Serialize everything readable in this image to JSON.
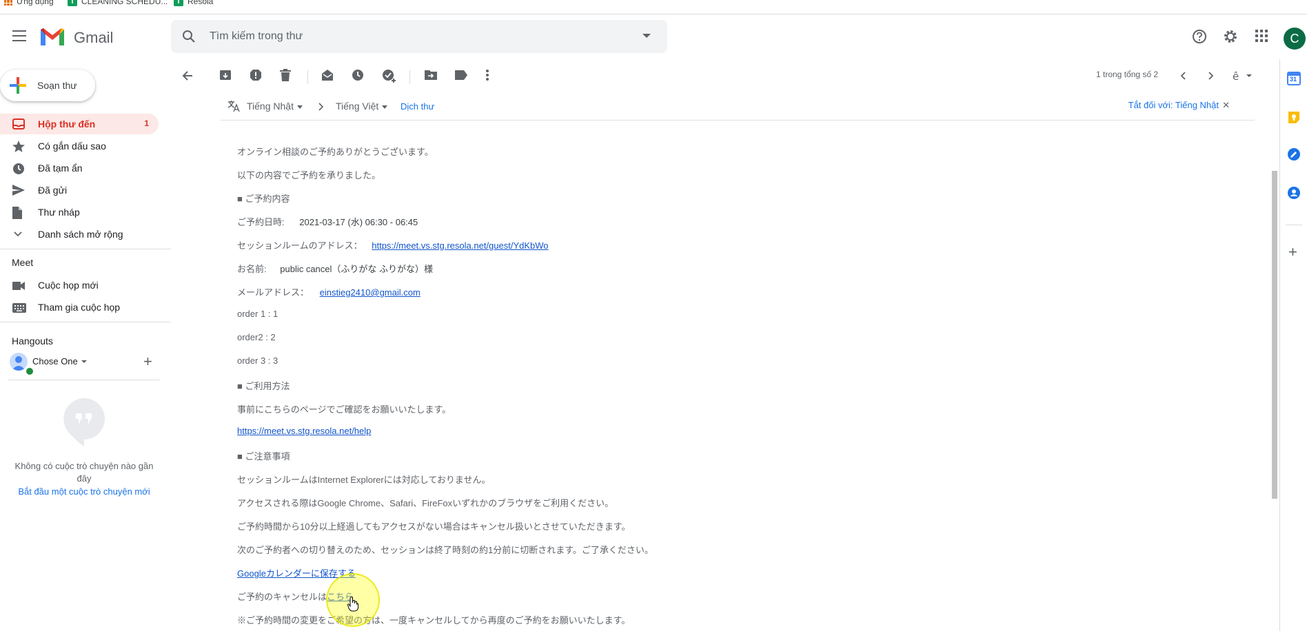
{
  "bookmarks": [
    {
      "label": "Ứng dụng",
      "icon": "apps-grid-icon"
    },
    {
      "label": "CLEANING SCHEDU...",
      "icon": "sheet-icon"
    },
    {
      "label": "Resola",
      "icon": "sheet-icon"
    }
  ],
  "header": {
    "app_name": "Gmail",
    "search_placeholder": "Tìm kiếm trong thư",
    "avatar_letter": "C",
    "icons": [
      "help-icon",
      "settings-icon",
      "apps-icon"
    ]
  },
  "sidebar": {
    "compose_label": "Soạn thư",
    "items": [
      {
        "label": "Hộp thư đến",
        "count": "1",
        "icon": "inbox-icon",
        "active": true
      },
      {
        "label": "Có gắn dấu sao",
        "icon": "star-icon"
      },
      {
        "label": "Đã tạm ẩn",
        "icon": "clock-icon"
      },
      {
        "label": "Đã gửi",
        "icon": "send-icon"
      },
      {
        "label": "Thư nháp",
        "icon": "draft-icon"
      },
      {
        "label": "Danh sách mở rộng",
        "icon": "chevron-down-icon"
      }
    ],
    "meet": {
      "title": "Meet",
      "items": [
        {
          "label": "Cuộc họp mới",
          "icon": "video-icon"
        },
        {
          "label": "Tham gia cuộc họp",
          "icon": "keyboard-icon"
        }
      ]
    },
    "hangouts": {
      "title": "Hangouts",
      "user_name": "Chose One",
      "no_chats": "Không có cuộc trò chuyện nào gần đây",
      "start_chat": "Bắt đầu một cuộc trò chuyện mới"
    }
  },
  "toolbar": {
    "pager": "1 trong tổng số 2"
  },
  "translate_bar": {
    "source_lang": "Tiếng Nhật",
    "target_lang": "Tiếng Việt",
    "translate_label": "Dịch thư",
    "turn_off_label": "Tắt đối với: Tiếng Nhật"
  },
  "email": {
    "l1": "オンライン相談のご予約ありがとうございます。",
    "l2": "以下の内容でご予約を承りました。",
    "l3": "■ ご予約内容",
    "date_label": "ご予約日時:",
    "date_value": "2021-03-17 (水) 06:30 - 06:45",
    "room_label": "セッションルームのアドレス：",
    "room_link": "https://meet.vs.stg.resola.net/guest/YdKbWo",
    "name_label": "お名前:",
    "name_value": "public cancel（ふりがな ふりがな）様",
    "mail_label": "メールアドレス：",
    "mail_link": "einstieg2410@gmail.com",
    "order1": "order 1 : 1",
    "order2": "order2 : 2",
    "order3": "order 3 : 3",
    "usage_title": "■ ご利用方法",
    "usage_text": "事前にこちらのページでご確認をお願いいたします。",
    "help_link": "https://meet.vs.stg.resola.net/help",
    "notes_title": "■ ご注意事項",
    "note1": "セッションルームはInternet Explorerには対応しておりません。",
    "note2": "アクセスされる際はGoogle Chrome、Safari、FireFoxいずれかのブラウザをご利用ください。",
    "note3": "ご予約時間から10分以上経過してもアクセスがない場合はキャンセル扱いとさせていただきます。",
    "note4": "次のご予約者への切り替えのため、セッションは終了時刻の約1分前に切断されます。ご了承ください。",
    "calendar_link": "Googleカレンダーに保存する",
    "cancel_prefix": "ご予約のキャンセルは",
    "cancel_link": "こちら",
    "change_note": "※ご予約時間の変更をご希望の方は、一度キャンセルしてから再度のご予約をお願いいたします。"
  },
  "right_panel": {
    "icons": [
      "calendar-icon",
      "keep-icon",
      "tasks-icon",
      "contacts-icon",
      "add-icon"
    ],
    "calendar_day": "31"
  },
  "colors": {
    "gmail_red": "#d93025",
    "link_blue": "#1155cc",
    "active_bg": "#fce8e6",
    "avatar_green": "#0b6b45"
  }
}
